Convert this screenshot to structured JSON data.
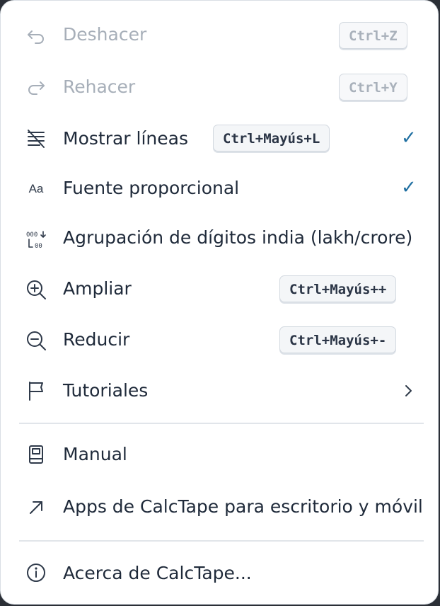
{
  "menu": {
    "items": [
      {
        "id": "undo",
        "label": "Deshacer",
        "shortcut": "Ctrl+Z",
        "icon": "undo-icon",
        "disabled": true
      },
      {
        "id": "redo",
        "label": "Rehacer",
        "shortcut": "Ctrl+Y",
        "icon": "redo-icon",
        "disabled": true
      },
      {
        "id": "show-lines",
        "label": "Mostrar líneas",
        "shortcut": "Ctrl+Mayús+L",
        "icon": "lines-icon",
        "checked": true
      },
      {
        "id": "proportional-font",
        "label": "Fuente proporcional",
        "icon": "font-icon",
        "icon_text": "Aa",
        "checked": true
      },
      {
        "id": "indian-grouping",
        "label": "Agrupación de dígitos india (lakh/crore)",
        "icon": "digit-grouping-icon"
      },
      {
        "id": "zoom-in",
        "label": "Ampliar",
        "shortcut": "Ctrl+Mayús++",
        "icon": "zoom-in-icon"
      },
      {
        "id": "zoom-out",
        "label": "Reducir",
        "shortcut": "Ctrl+Mayús+-",
        "icon": "zoom-out-icon"
      },
      {
        "id": "tutorials",
        "label": "Tutoriales",
        "icon": "flag-icon",
        "submenu": true
      },
      {
        "id": "manual",
        "label": "Manual",
        "icon": "book-icon"
      },
      {
        "id": "apps",
        "label": "Apps de CalcTape para escritorio y móvil",
        "icon": "external-arrow-icon"
      },
      {
        "id": "about",
        "label": "Acerca de CalcTape...",
        "icon": "info-icon"
      }
    ],
    "check_mark": "✓",
    "colors": {
      "text": "#1f2a3a",
      "disabled": "#a7afb9",
      "check": "#1f6fa1"
    }
  }
}
